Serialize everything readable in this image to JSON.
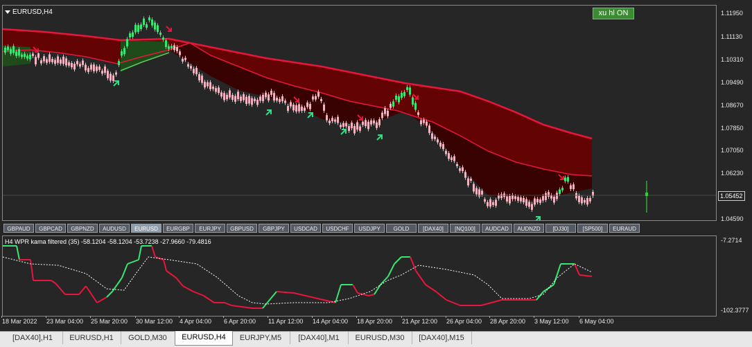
{
  "main_chart": {
    "title": "EURUSD,H4",
    "button_label": "xu hl ON",
    "price_ticks": [
      "1.11950",
      "1.11130",
      "1.10310",
      "1.09490",
      "1.08670",
      "1.07850",
      "1.07050",
      "1.06230",
      "1.05452",
      "1.04590"
    ],
    "current_price": "1.05452"
  },
  "symbols": [
    "GBPAUD",
    "GBPCAD",
    "GBPNZD",
    "AUDUSD",
    "EURUSD",
    "EURGBP",
    "EURJPY",
    "GBPUSD",
    "GBPJPY",
    "USDCAD",
    "USDCHF",
    "USDJPY",
    "GOLD",
    "[DAX40]",
    "[NQ100]",
    "AUDCAD",
    "AUDNZD",
    "[DJ30]",
    "[SP500]",
    "EURAUD"
  ],
  "active_symbol": "EURUSD",
  "indicator": {
    "label": "H4  WPR kama filtered (35) -58.1204 -58.1204 -53.7238 -27.9660 -79.4816",
    "top_value": "-7.2714",
    "bottom_value": "-102.3777"
  },
  "time_axis": [
    "18 Mar 2022",
    "23 Mar 04:00",
    "25 Mar 20:00",
    "30 Mar 12:00",
    "4 Apr 04:00",
    "6 Apr 20:00",
    "11 Apr 12:00",
    "14 Apr 04:00",
    "18 Apr 20:00",
    "21 Apr 12:00",
    "26 Apr 04:00",
    "28 Apr 20:00",
    "3 May 12:00",
    "6 May 04:00"
  ],
  "tabs": [
    "[DAX40],H1",
    "EURUSD,H1",
    "GOLD,M30",
    "EURUSD,H4",
    "EURJPY,M5",
    "[DAX40],M1",
    "EURUSD,M30",
    "[DAX40],M15"
  ],
  "active_tab": "EURUSD,H4",
  "colors": {
    "background": "#262626",
    "bear_band": "#6b0000",
    "bull_band": "#1f4a1a",
    "ema_line": "#e8163c",
    "bull_candle": "#39e673",
    "bear_candle": "#f0b4c0",
    "signal_green": "#33dd88",
    "signal_red": "#e8163c"
  }
}
